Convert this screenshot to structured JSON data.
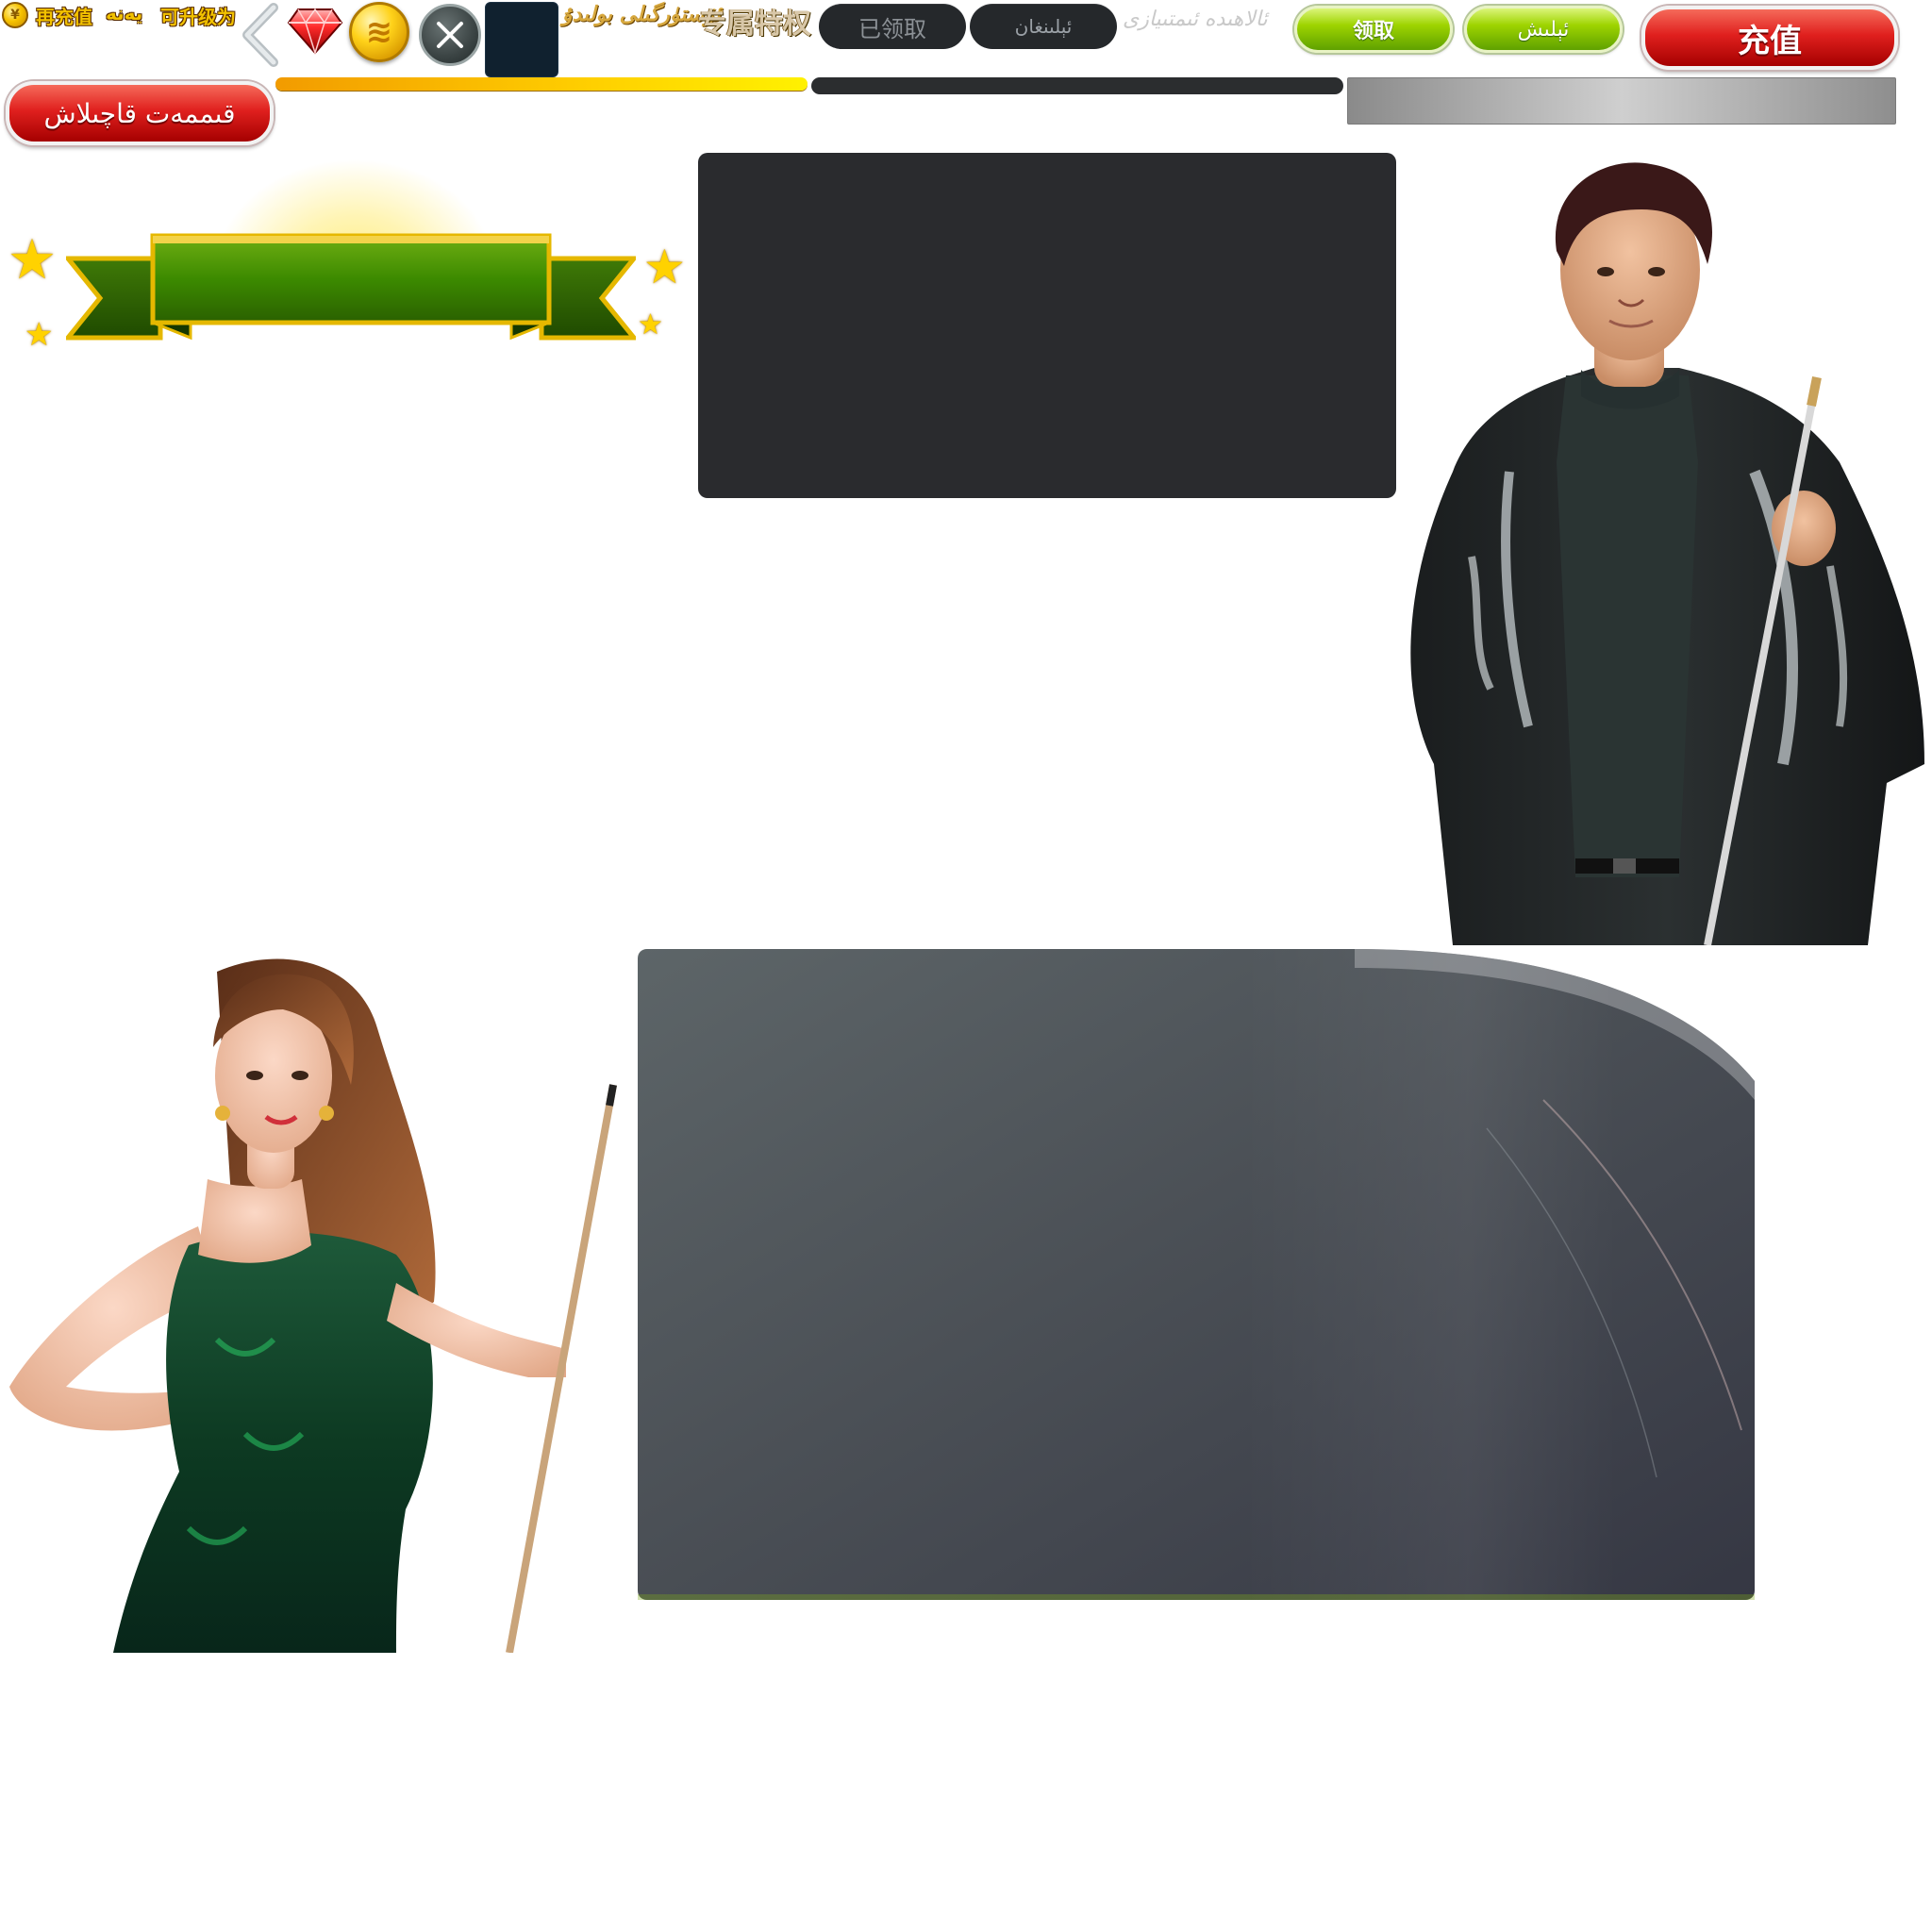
{
  "topbar": {
    "recharge_again": "再充值",
    "next": "يەنە",
    "upgrade_to": "可升级为",
    "exclusive_privilege_ug": "ئۆستۈرگىلى بولىدۇ",
    "exclusive_privilege": "专属特权",
    "claimed": "已领取",
    "claimed_ug": "ئېلىنغان",
    "privileges_ug": "ئالاھىدە ئىمتىيازى",
    "claim": "领取",
    "claim_ug": "ئېلىش",
    "recharge": "充值",
    "value_recharge_ug": "قىممەت قاچىلاش"
  },
  "progress": {
    "primary_fraction": 1.0,
    "secondary_fraction": 0.0
  },
  "colors": {
    "gold": "#f2c200",
    "green": "#7cc100",
    "red": "#d81e1e",
    "panel_dark": "#2a2b2e"
  },
  "icons": [
    "coin-icon",
    "chevron-left-icon",
    "gem-icon",
    "gold-coin-icon",
    "close-icon",
    "star-icon"
  ]
}
